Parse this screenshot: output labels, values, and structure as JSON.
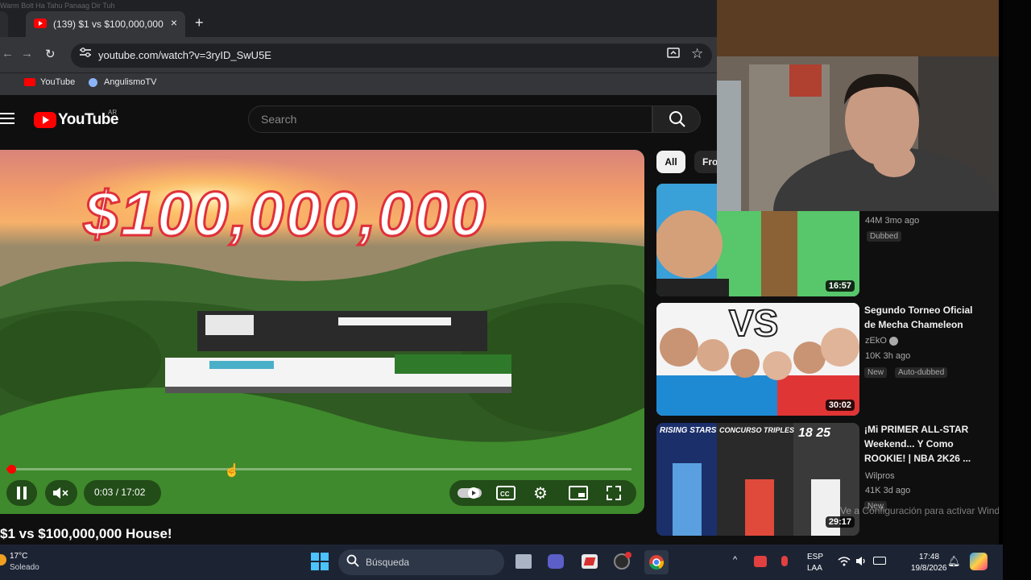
{
  "browser": {
    "faint_top_text": "Warm Bolt Ha Tahu Panaag Dir Tuh",
    "tab_title": "(139) $1 vs $100,000,000 House!",
    "tab_close": "×",
    "new_tab": "+",
    "url": "youtube.com/watch?v=3ryID_SwU5E",
    "nav_back": "←",
    "nav_forward": "→",
    "nav_reload": "↻",
    "bookmarks": [
      {
        "label": "YouTube",
        "icon": "youtube-icon"
      },
      {
        "label": "AngulismoTV",
        "icon": "globe-icon"
      }
    ]
  },
  "youtube": {
    "logo_text": "YouTube",
    "region": "AR",
    "search_placeholder": "Search",
    "video": {
      "thumb_overlay_text": "$100,000,000",
      "time": "0:03 / 17:02",
      "progress": 0.003,
      "title": "$1 vs $100,000,000 House!"
    },
    "chips": [
      "All",
      "From"
    ],
    "recommendations": [
      {
        "title": "",
        "meta": "44M  3mo ago",
        "badges": [
          "Dubbed"
        ],
        "duration": "16:57"
      },
      {
        "title": "Segundo Torneo Oficial de Mecha Chameleon",
        "channel": "zEkO",
        "meta": "10K  3h ago",
        "badges": [
          "New",
          "Auto-dubbed"
        ],
        "duration": "30:02",
        "thumb_text": "VS"
      },
      {
        "title": "¡Mi PRIMER ALL-STAR Weekend... Y Como ROOKIE! | NBA 2K26 ...",
        "channel": "Wilpros",
        "meta": "41K  3d ago",
        "badges": [
          "New"
        ],
        "duration": "29:17",
        "thumb_labels": [
          "RISING STARS",
          "CONCURSO TRIPLES",
          "18 25"
        ]
      }
    ]
  },
  "windows": {
    "watermark": "Ve a Configuración para activar Windows.",
    "weather_temp": "17°C",
    "weather_desc": "Soleado",
    "search_placeholder": "Búsqueda",
    "lang_1": "ESP",
    "lang_2": "LAA",
    "time": "17:48",
    "date": "19/8/2026"
  },
  "colors": {
    "accent": "#ff0000",
    "background": "#0f0f0f",
    "taskbar": "#1c2434"
  }
}
